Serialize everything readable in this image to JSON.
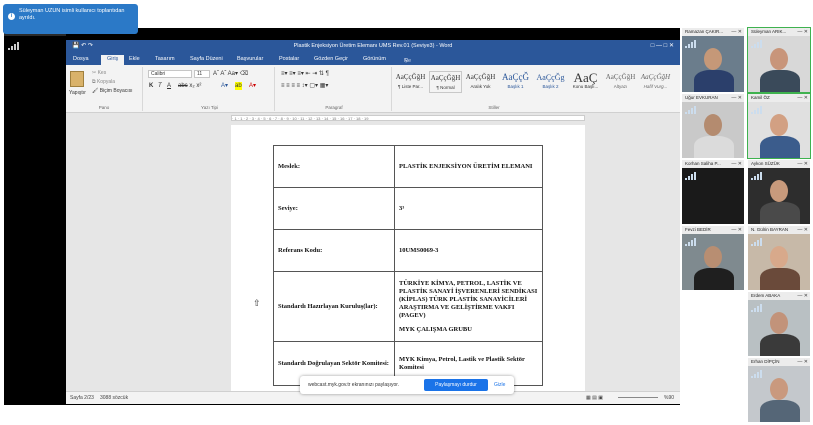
{
  "notification": {
    "text": "Süleyman UZUN isimli kullanıcı toplantıdan ayrıldı.",
    "icon": "info-icon"
  },
  "presenter_label": "Kamil ÖZ - Masaüstü",
  "word": {
    "title": "Plastik Enjeksiyon Üretim Elemanı UMS Rev.01 (Seviye3) - Word",
    "menu": [
      "Dosya",
      "Giriş",
      "Ekle",
      "Tasarım",
      "Sayfa Düzeni",
      "Başvurular",
      "Postalar",
      "Gözden Geçir",
      "Görünüm"
    ],
    "active_menu": "Giriş",
    "tell_me": "Ne yapmak istediğinizi bana söyleyin...",
    "ribbon": {
      "paste": "Yapıştır",
      "cut": "Kes",
      "copy": "Kopyala",
      "format_painter": "Biçim Boyacısı",
      "clipboard_group": "Pano",
      "font_name": "Calibri",
      "font_size": "11",
      "font_group": "Yazı Tipi",
      "paragraph_group": "Paragraf",
      "styles_group": "Stiller",
      "styles": [
        {
          "preview": "AaÇçĞğH",
          "name": "¶ Liste Par..."
        },
        {
          "preview": "AaÇçĞğH",
          "name": "¶ Normal"
        },
        {
          "preview": "AaÇçĞğH",
          "name": "Aralık Yok"
        },
        {
          "preview": "AaÇçĞ",
          "name": "Başlık 1"
        },
        {
          "preview": "AaÇçĞg",
          "name": "Başlık 2"
        },
        {
          "preview": "AaÇ",
          "name": "Konu Başlı..."
        },
        {
          "preview": "AaÇçĞğH",
          "name": "Altyazı"
        },
        {
          "preview": "AaÇçĞğH",
          "name": "Hafif Vurg..."
        }
      ]
    },
    "table": [
      {
        "key": "Meslek:",
        "value": "PLASTİK ENJEKSİYON ÜRETİM ELEMANI"
      },
      {
        "key": "Seviye:",
        "value": "3³"
      },
      {
        "key": "Referans Kodu:",
        "value": "10UMS0069-3"
      },
      {
        "key": "Standardı Hazırlayan Kuruluş(lar):",
        "value": "TÜRKİYE KİMYA, PETROL, LASTİK VE PLASTİK SANAYİ İŞVERENLERİ SENDİKASI (KİPLAS) TÜRK PLASTİK SANAYİCİLERİ ARAŞTIRMA VE GELİŞTİRME VAKFI (PAGEV)",
        "extra": "MYK ÇALIŞMA GRUBU"
      },
      {
        "key": "Standardı Doğrulayan Sektör Komitesi:",
        "value": "MYK Kimya, Petrol, Lastik ve Plastik Sektör Komitesi"
      }
    ],
    "status": {
      "page": "Sayfa 2/23",
      "words": "3088 sözcük",
      "zoom": "%90"
    }
  },
  "share_bar": {
    "message": "webcast.myk.gov.tr ekranınızı paylaşıyor.",
    "stop": "Paylaşmayı durdur",
    "hide": "Gizle"
  },
  "participants": [
    {
      "name": "Ramazan ÇAKIR...",
      "green": false
    },
    {
      "name": "Süleyman ARIK...",
      "green": true
    },
    {
      "name": "Uğur EVKURAN",
      "green": false
    },
    {
      "name": "Kamil ÖZ",
      "green": true
    },
    {
      "name": "Korhan Saliha P...",
      "green": false
    },
    {
      "name": "Aykon SÜZÜK",
      "green": false
    },
    {
      "name": "Fevzi BEDİR",
      "green": false
    },
    {
      "name": "N. Gülrin BAYRAN",
      "green": false
    },
    {
      "name": "Erdem ABAKA",
      "green": false
    },
    {
      "name": "Erhan DİPÇİN",
      "green": false
    }
  ],
  "colors": {
    "word_blue": "#2b579a",
    "active_speaker": "#3fb24f",
    "stop_button": "#1a73e8"
  }
}
